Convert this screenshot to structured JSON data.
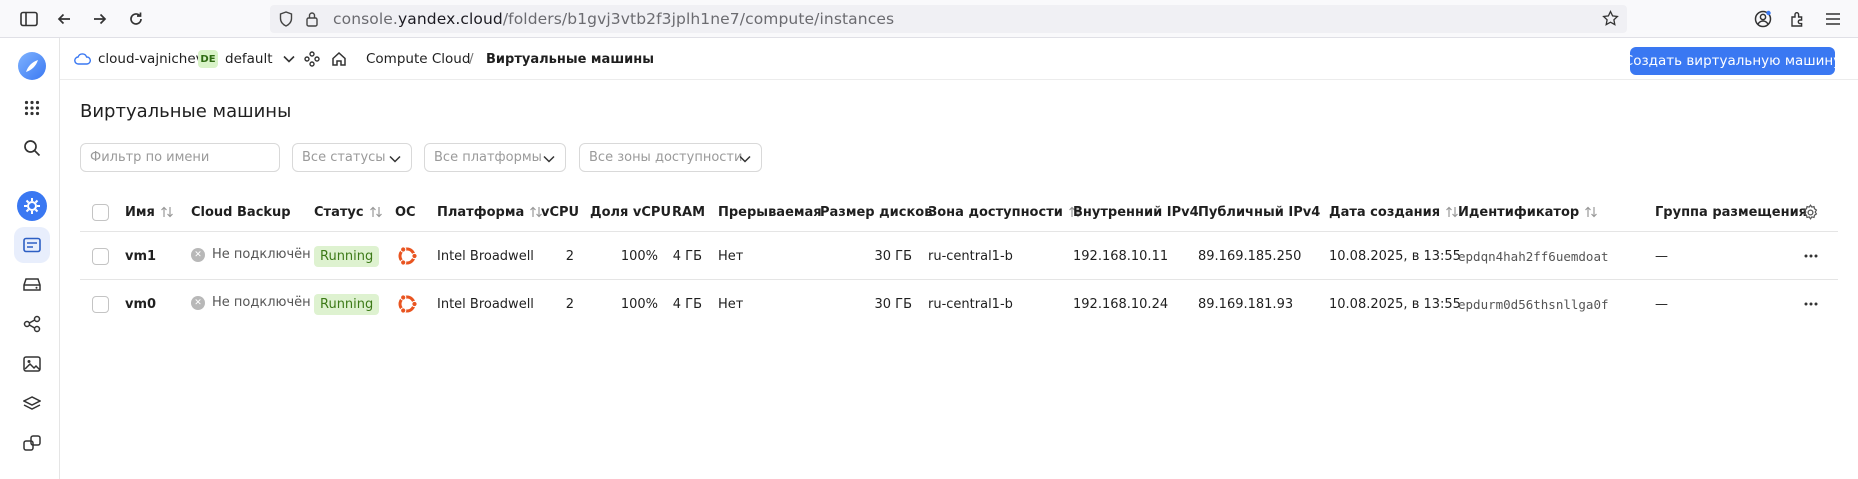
{
  "browser": {
    "url_prefix": "console.",
    "url_host": "yandex.cloud",
    "url_path": "/folders/b1gvj3vtb2f3jplh1ne7/compute/instances"
  },
  "header": {
    "cloud": "cloud-vajnichev",
    "folder_badge": "DE",
    "folder": "default",
    "service": "Compute Cloud",
    "separator": "/",
    "current": "Виртуальные машины",
    "create_button": "Создать виртуальную машину"
  },
  "page": {
    "title": "Виртуальные машины"
  },
  "filters": {
    "name_placeholder": "Фильтр по имени",
    "status": "Все статусы",
    "platform": "Все платформы",
    "zone": "Все зоны доступности"
  },
  "table": {
    "columns": {
      "name": "Имя",
      "backup": "Cloud Backup",
      "status": "Статус",
      "os": "ОС",
      "platform": "Платформа",
      "vcpu": "vCPU",
      "vcpu_share": "Доля vCPU",
      "ram": "RAM",
      "preemptible": "Прерываемая",
      "disk": "Размер дисков",
      "zone": "Зона доступности",
      "ipv4_internal": "Внутренний IPv4",
      "ipv4_public": "Публичный IPv4",
      "created": "Дата создания",
      "id": "Идентификатор",
      "placement": "Группа размещения"
    },
    "rows": [
      {
        "name": "vm1",
        "backup": "Не подключён",
        "status": "Running",
        "os_icon": "ubuntu-icon",
        "platform": "Intel Broadwell",
        "vcpu": "2",
        "vcpu_share": "100%",
        "ram": "4 ГБ",
        "preemptible": "Нет",
        "disk": "30 ГБ",
        "zone": "ru-central1-b",
        "ipv4_internal": "192.168.10.11",
        "ipv4_public": "89.169.185.250",
        "created": "10.08.2025, в 13:55",
        "id": "epdqn4hah2ff6uemdoat",
        "placement": "—"
      },
      {
        "name": "vm0",
        "backup": "Не подключён",
        "status": "Running",
        "os_icon": "ubuntu-icon",
        "platform": "Intel Broadwell",
        "vcpu": "2",
        "vcpu_share": "100%",
        "ram": "4 ГБ",
        "preemptible": "Нет",
        "disk": "30 ГБ",
        "zone": "ru-central1-b",
        "ipv4_internal": "192.168.10.24",
        "ipv4_public": "89.169.181.93",
        "created": "10.08.2025, в 13:55",
        "id": "epdurm0d56thsnllga0f",
        "placement": "—"
      }
    ]
  },
  "colors": {
    "accent": "#3a78f2",
    "running_bg": "#def2d0",
    "running_text": "#3c7a17",
    "ubuntu": "#e95420"
  }
}
